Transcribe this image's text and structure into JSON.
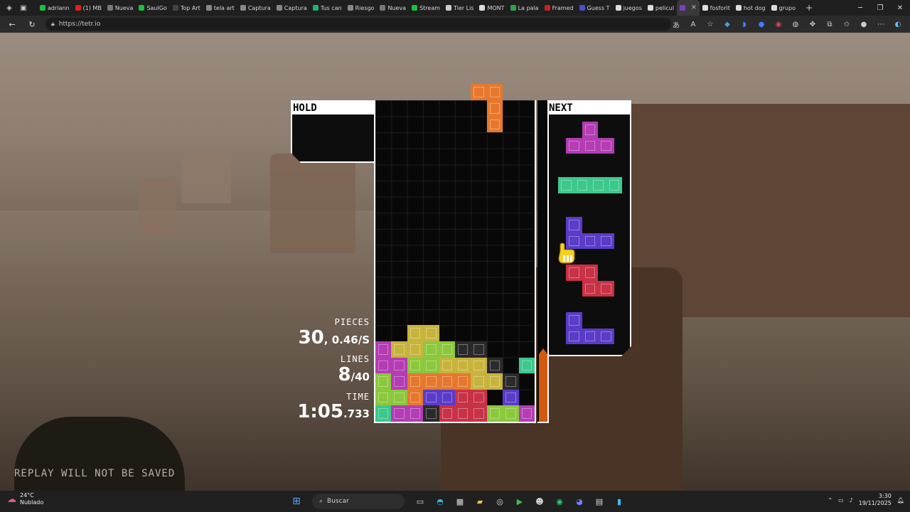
{
  "browser": {
    "tabs": [
      {
        "title": "adriann",
        "color": "#19c13a",
        "active": false
      },
      {
        "title": "(1) MB",
        "color": "#e02020",
        "active": false
      },
      {
        "title": "Nueva",
        "color": "#777777",
        "active": false
      },
      {
        "title": "SaulGo",
        "color": "#19c13a",
        "active": false
      },
      {
        "title": "Top Art",
        "color": "#444444",
        "active": false
      },
      {
        "title": "tela art",
        "color": "#888888",
        "active": false
      },
      {
        "title": "Captura",
        "color": "#888888",
        "active": false
      },
      {
        "title": "Captura",
        "color": "#888888",
        "active": false
      },
      {
        "title": "Tus can",
        "color": "#1bb36b",
        "active": false
      },
      {
        "title": "Riesgo",
        "color": "#888888",
        "active": false
      },
      {
        "title": "Nueva",
        "color": "#777777",
        "active": false
      },
      {
        "title": "Stream",
        "color": "#19c13a",
        "active": false
      },
      {
        "title": "Tier Lis",
        "color": "#cccccc",
        "active": false
      },
      {
        "title": "MONT",
        "color": "#dddddd",
        "active": false
      },
      {
        "title": "La pala",
        "color": "#2ea44f",
        "active": false
      },
      {
        "title": "Framed",
        "color": "#c82020",
        "active": false
      },
      {
        "title": "Guess T",
        "color": "#4a50c0",
        "active": false
      },
      {
        "title": "juegos",
        "color": "#dddddd",
        "active": false
      },
      {
        "title": "pelicul",
        "color": "#dddddd",
        "active": false
      },
      {
        "title": "",
        "color": "#7a40c0",
        "active": true
      },
      {
        "title": "fosforit",
        "color": "#dddddd",
        "active": false
      },
      {
        "title": "hot dog",
        "color": "#dddddd",
        "active": false
      },
      {
        "title": "grupo",
        "color": "#dddddd",
        "active": false
      }
    ],
    "new_tab": "+",
    "url": "https://tetr.io"
  },
  "game": {
    "hold_label": "HOLD",
    "next_label": "NEXT",
    "stats": {
      "pieces_label": "PIECES",
      "pieces_value": "30",
      "pieces_rate": ", 0.46/S",
      "lines_label": "LINES",
      "lines_value": "8",
      "lines_total": "/40",
      "time_label": "TIME",
      "time_value": "1:05",
      "time_ms": ".733"
    },
    "replay_note": "REPLAY WILL NOT BE SAVED",
    "garbage_meter_level": 0.21,
    "colors": {
      "T": "#b43cb4",
      "I": "#3cc88c",
      "J": "#5a3cc8",
      "Z": "#c83246",
      "L": "#e6782d",
      "O": "#c8b43c",
      "S": "#8cc83c",
      "G": "#2a2a2a"
    },
    "falling_piece": {
      "type": "L",
      "cells": [
        [
          6,
          -1
        ],
        [
          7,
          -1
        ],
        [
          7,
          0
        ],
        [
          7,
          1
        ]
      ]
    },
    "board_rows_from_bottom": [
      "ITTGZZZSSTT",
      "SSLJJZZ.J I",
      "STLLLLOOG.I",
      "TTSSOOOG.I.",
      "TOOSSGG....",
      "..OO......."
    ],
    "next_queue": [
      "T",
      "I",
      "J",
      "Z",
      "J"
    ]
  },
  "taskbar": {
    "temp": "24°C",
    "condition": "Nublado",
    "search_placeholder": "Buscar",
    "time": "3:30",
    "date": "19/11/2025"
  }
}
